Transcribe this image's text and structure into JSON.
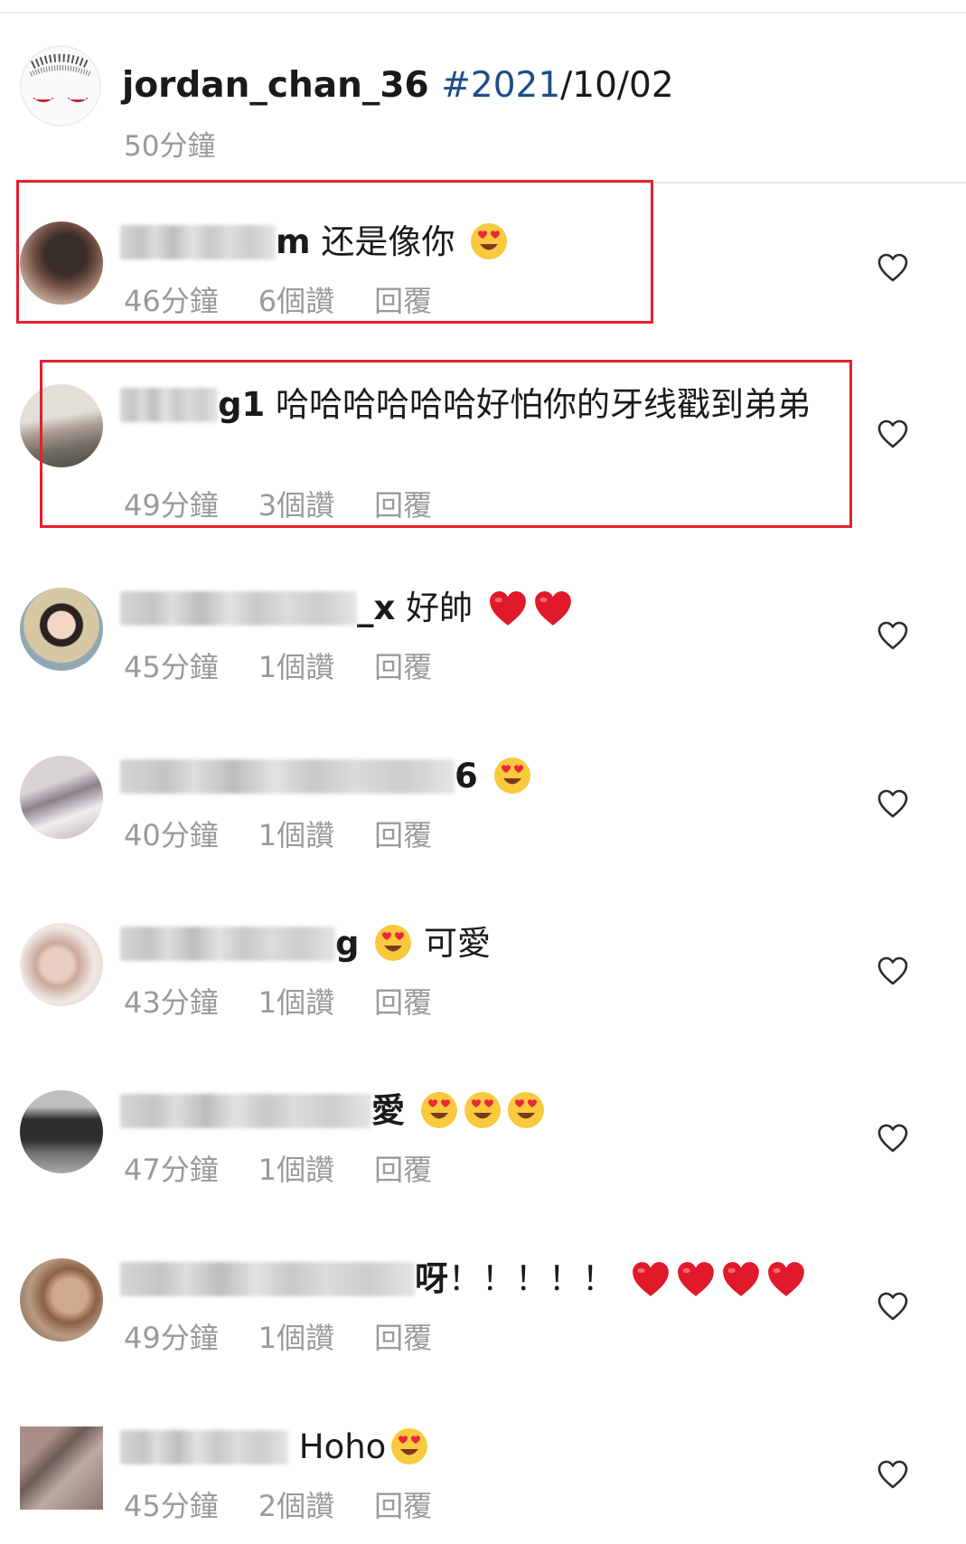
{
  "post": {
    "username": "jordan_chan_36",
    "hashtag": "#2021",
    "date_suffix": "/10/02",
    "time": "50分鐘"
  },
  "icons": {
    "like": "heart-outline-icon",
    "emoji_love": "heart-eyes-emoji",
    "emoji_heart": "red-heart-emoji"
  },
  "colors": {
    "highlight_box": "#e5202a",
    "hashtag": "#1d4e89",
    "meta_text": "#9a9a9a"
  },
  "comments": [
    {
      "visible_text": "m",
      "text": "还是像你",
      "emoji": "😍",
      "time": "46分鐘",
      "likes": "6個讚",
      "reply": "回覆"
    },
    {
      "visible_text": "g1",
      "text": "哈哈哈哈哈哈好怕你的牙线戳到弟弟",
      "time": "49分鐘",
      "likes": "3個讚",
      "reply": "回覆"
    },
    {
      "visible_text": "_x",
      "text": "好帥",
      "emoji": "❤️❤️",
      "time": "45分鐘",
      "likes": "1個讚",
      "reply": "回覆"
    },
    {
      "visible_text": "6",
      "text": "",
      "emoji": "😍",
      "time": "40分鐘",
      "likes": "1個讚",
      "reply": "回覆"
    },
    {
      "visible_text": "g",
      "text": "可愛",
      "emoji": "😍",
      "time": "43分鐘",
      "likes": "1個讚",
      "reply": "回覆"
    },
    {
      "visible_text": "愛",
      "text": "",
      "emoji": "😍😍😍",
      "time": "47分鐘",
      "likes": "1個讚",
      "reply": "回覆"
    },
    {
      "visible_text": "呀",
      "text": "！！！！！",
      "emoji": "❤️❤️❤️❤️",
      "time": "49分鐘",
      "likes": "1個讚",
      "reply": "回覆"
    },
    {
      "visible_text": "",
      "text": "Hoho",
      "emoji": "😍",
      "time": "45分鐘",
      "likes": "2個讚",
      "reply": "回覆"
    }
  ]
}
